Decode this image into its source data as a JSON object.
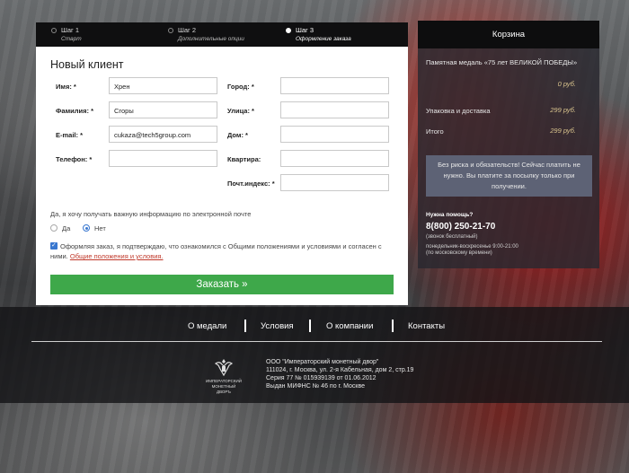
{
  "steps": [
    {
      "title": "Шаг 1",
      "sub": "Старт"
    },
    {
      "title": "Шаг 2",
      "sub": "Дополнительные опции"
    },
    {
      "title": "Шаг 3",
      "sub": "Оформление заказа"
    }
  ],
  "form": {
    "title": "Новый клиент",
    "labels": {
      "name": "Имя: *",
      "surname": "Фамилия: *",
      "email": "E-mail: *",
      "phone": "Телефон: *",
      "city": "Город: *",
      "street": "Улица: *",
      "house": "Дом: *",
      "apartment": "Квартира:",
      "zip": "Почт.индекс: *"
    },
    "values": {
      "name": "Хрен",
      "surname": "Сгоры",
      "email": "cukaza@tech5group.com",
      "phone": "",
      "city": "",
      "street": "",
      "house": "",
      "apartment": "",
      "zip": ""
    },
    "newsletter_question": "Да, я хочу получать важную информацию по электронной почте",
    "radio_yes": "Да",
    "radio_no": "Нет",
    "agree_text": "Оформляя заказ, я подтверждаю, что ознакомился с Общими положениями и условиями и согласен с ними.",
    "agree_link": "Общие положения и условия.",
    "order_button": "Заказать »"
  },
  "cart": {
    "title": "Корзина",
    "item_name": "Памятная медаль «75 лет ВЕЛИКОЙ ПОБЕДЫ»",
    "item_price": "0 руб.",
    "shipping_label": "Упаковка и доставка",
    "shipping_price": "299 руб.",
    "total_label": "Итого",
    "total_price": "299 руб.",
    "notice": "Без риска и обязательств! Сейчас платить не нужно. Вы платите за посылку только при получении.",
    "help_label": "Нужна помощь?",
    "phone": "8(800) 250-21-70",
    "free_call": "(звонок бесплатный)",
    "hours": "понедельник-воскресенье 9:00-21:00",
    "timezone": "(по московскому времени)"
  },
  "footer": {
    "nav": [
      "О медали",
      "Условия",
      "О компании",
      "Контакты"
    ],
    "logo_caption": [
      "ИМПЕРАТОРСКИЙ",
      "МОНЕТНЫЙ",
      "ДВОРЪ"
    ],
    "legal": [
      "ООО \"Императорский монетный двор\"",
      "111024, г. Москва, ул. 2-я Кабельная, дом 2, стр.19",
      "Серия 77 № 015939139 от 01.06.2012",
      "Выдан МИФНС № 46 по г. Москве"
    ]
  },
  "colors": {
    "accent_green": "#3ea84a",
    "radio_blue": "#3a78d0",
    "link_red": "#c0392b",
    "price_gold": "#d8c38d"
  }
}
